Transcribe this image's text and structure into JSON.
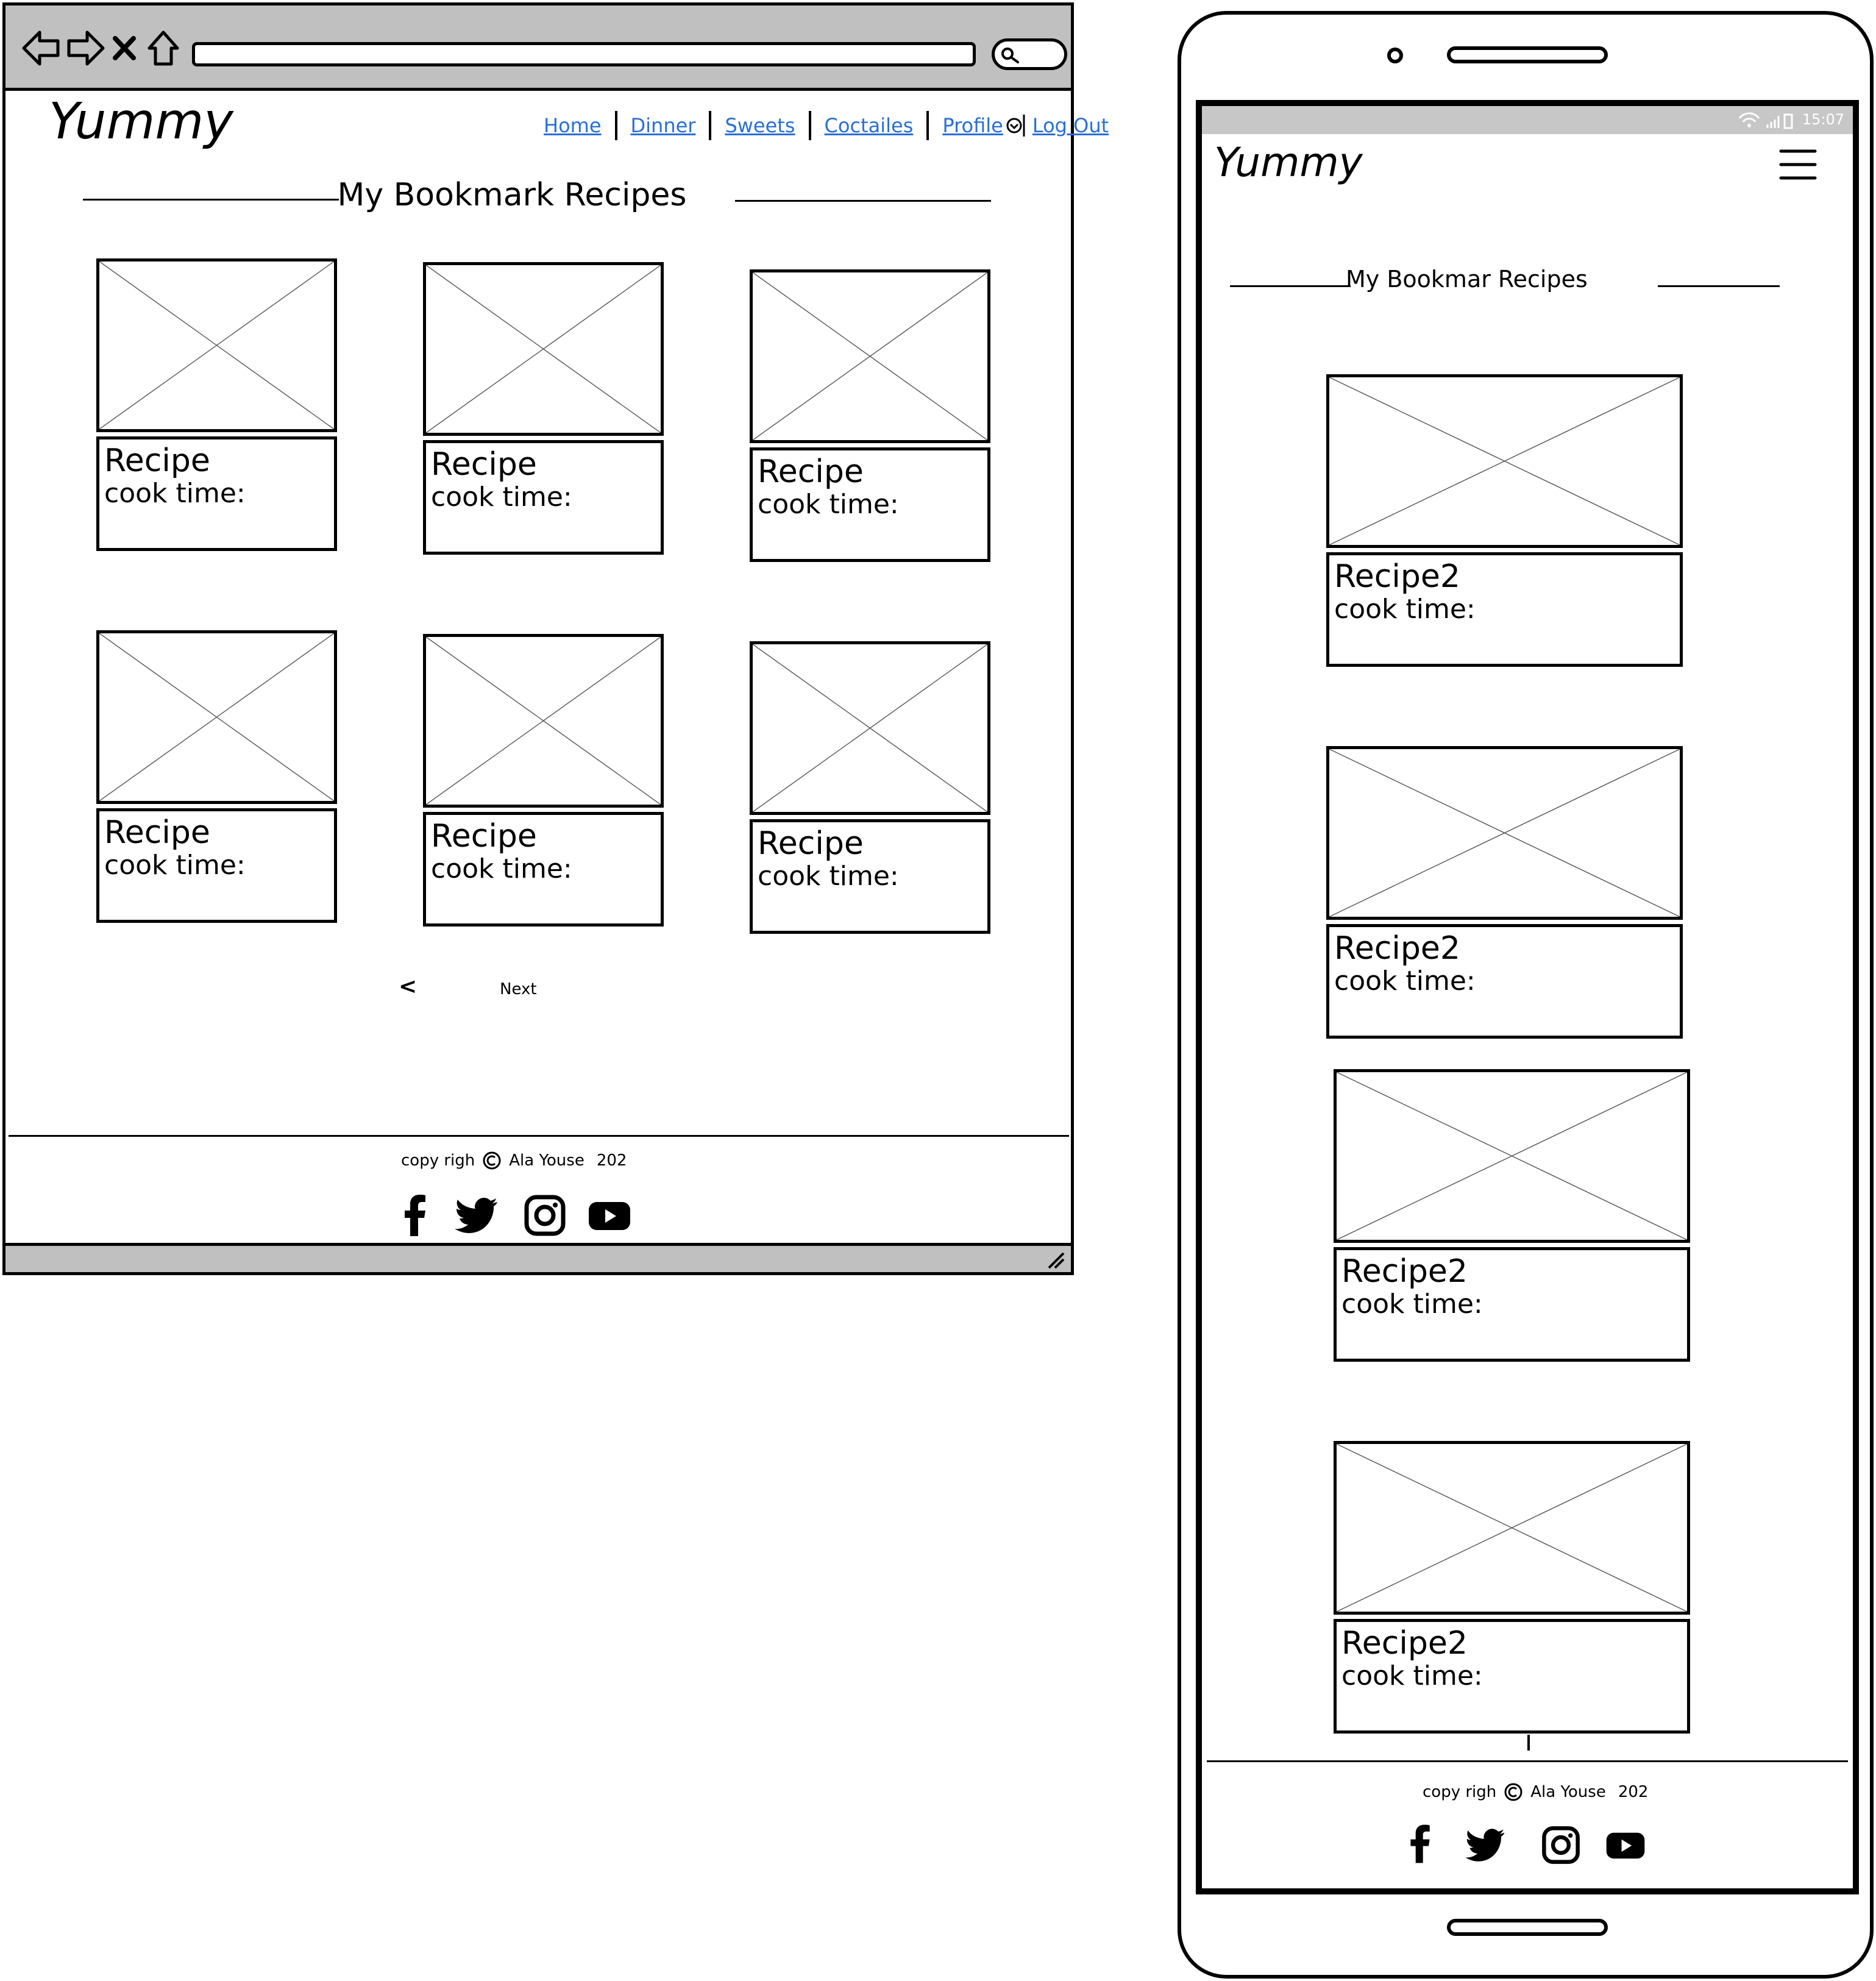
{
  "desktop": {
    "logo": "Yummy",
    "nav": [
      "Home",
      "Dinner",
      "Sweets",
      "Coctailes",
      "Profile",
      "Log Out"
    ],
    "title": "My Bookmark Recipes",
    "cards": [
      {
        "title": "Recipe",
        "cook_time": "cook time:"
      },
      {
        "title": "Recipe",
        "cook_time": "cook time:"
      },
      {
        "title": "Recipe",
        "cook_time": "cook time:"
      },
      {
        "title": "Recipe",
        "cook_time": "cook time:"
      },
      {
        "title": "Recipe",
        "cook_time": "cook time:"
      },
      {
        "title": "Recipe",
        "cook_time": "cook time:"
      }
    ],
    "pager": {
      "prev": "<",
      "next": "Next"
    },
    "footer": {
      "copy_left": "copy righ",
      "author": "Ala Youse",
      "year": "202"
    }
  },
  "mobile": {
    "status_time": "15:07",
    "logo": "Yummy",
    "title": "My Bookmar Recipes",
    "cards": [
      {
        "title": "Recipe2",
        "cook_time": "cook time:"
      },
      {
        "title": "Recipe2",
        "cook_time": "cook time:"
      },
      {
        "title": "Recipe2",
        "cook_time": "cook time:"
      },
      {
        "title": "Recipe2",
        "cook_time": "cook time:"
      }
    ],
    "footer": {
      "copy_left": "copy righ",
      "author": "Ala Youse",
      "year": "202"
    }
  },
  "icons": {
    "back": "back-arrow-icon",
    "forward": "forward-arrow-icon",
    "close": "close-icon",
    "home": "home-icon",
    "search": "search-icon",
    "menu": "hamburger-menu-icon",
    "copyright": "copyright-icon",
    "social": [
      "facebook-icon",
      "twitter-icon",
      "instagram-icon",
      "youtube-icon"
    ]
  },
  "colors": {
    "link": "#2a6fd6",
    "chrome": "#c0c0c0",
    "status_bar": "#c7c7c7"
  }
}
